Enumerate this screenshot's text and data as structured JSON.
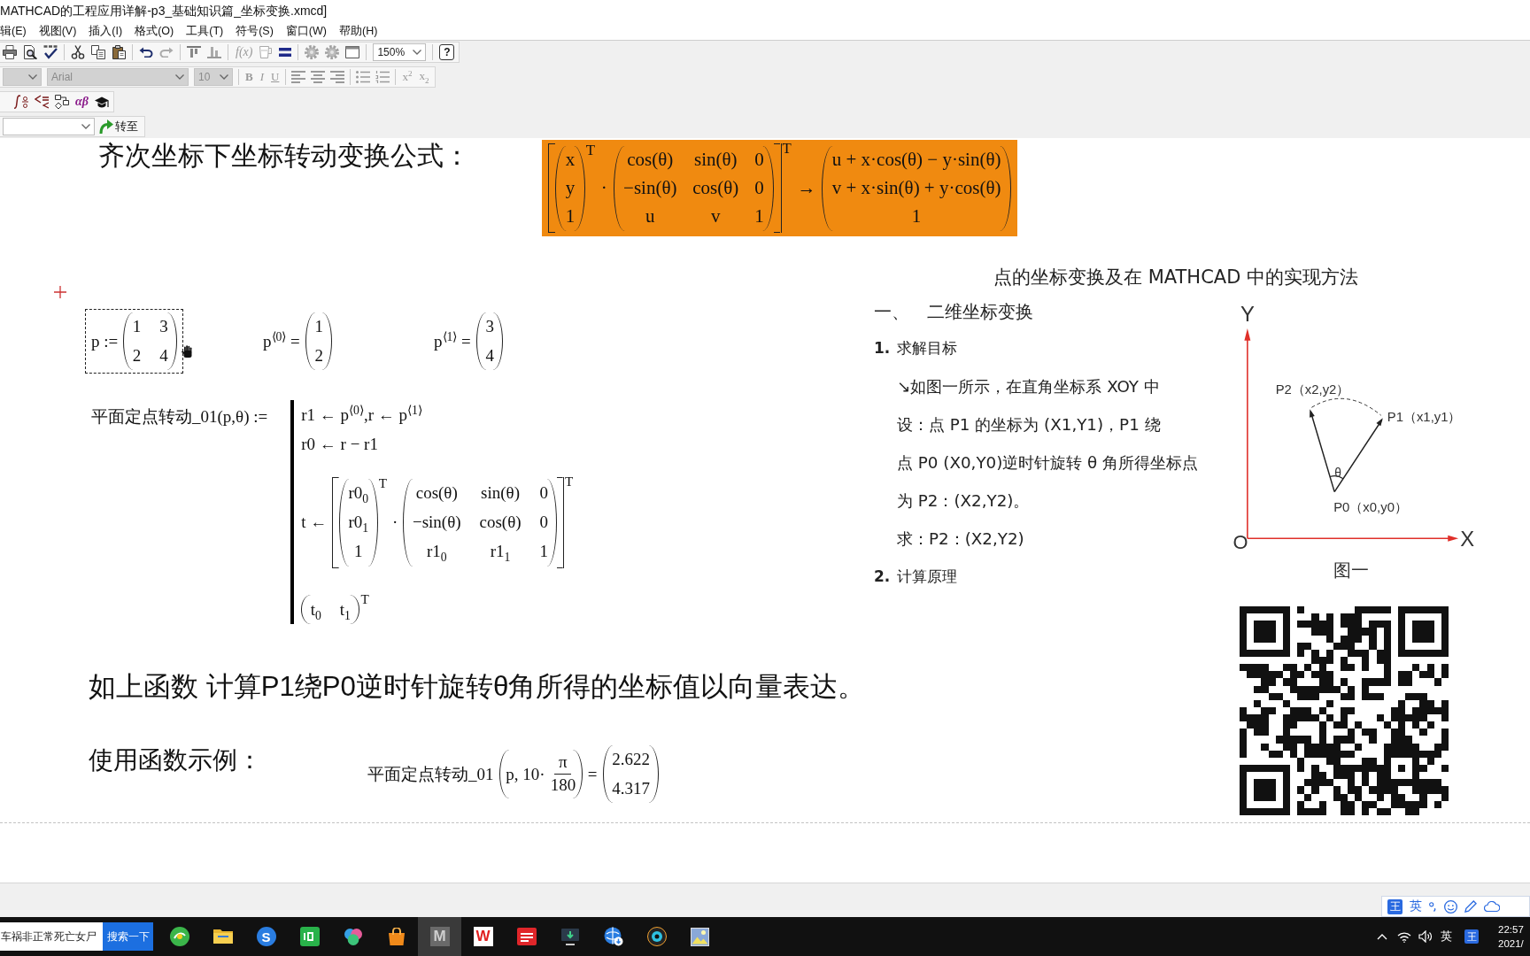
{
  "window": {
    "title": "MATHCAD的工程应用详解-p3_基础知识篇_坐标变换.xmcd]"
  },
  "menu": [
    "辑(E)",
    "视图(V)",
    "插入(I)",
    "格式(O)",
    "工具(T)",
    "符号(S)",
    "窗口(W)",
    "帮助(H)"
  ],
  "standard_toolbar": {
    "function": {
      "label": "f(x)",
      "disabled": true
    },
    "zoom": "150%",
    "help": "?"
  },
  "formatting_toolbar": {
    "disabled": true,
    "font": "Arial",
    "size": "10",
    "styles": [
      "B",
      "I",
      "U"
    ],
    "scripts": [
      "x$^{2}$",
      "x$_{2}$"
    ]
  },
  "math_toolbar": {
    "greek": "αβ"
  },
  "resource_toolbar": {
    "goto": "转至"
  },
  "worksheet": {
    "regions": [
      {
        "kind": "text",
        "selected": false,
        "text": "齐次坐标下坐标转动变换公式："
      },
      {
        "kind": "math",
        "selected": false,
        "highlighted": true,
        "expr": [
          {
            "kind": "square_group",
            "sup": "T",
            "items": [
              {
                "kind": "matrix",
                "sup": "T",
                "rows": [
                  [
                    "x"
                  ],
                  [
                    "y"
                  ],
                  [
                    "1"
                  ]
                ]
              },
              {
                "kind": "text",
                "text": "·"
              },
              {
                "kind": "matrix",
                "rows": [
                  [
                    "cos(θ)",
                    "sin(θ)",
                    "0"
                  ],
                  [
                    "−sin(θ)",
                    "cos(θ)",
                    "0"
                  ],
                  [
                    "u",
                    "v",
                    "1"
                  ]
                ]
              }
            ]
          },
          {
            "kind": "text",
            "text": "→"
          },
          {
            "kind": "matrix",
            "rows": [
              [
                "u + x·cos(θ) − y·sin(θ)"
              ],
              [
                "v + x·sin(θ) + y·cos(θ)"
              ],
              [
                "1"
              ]
            ]
          }
        ]
      },
      {
        "kind": "math",
        "selected": true,
        "highlighted": false,
        "expr": [
          {
            "kind": "text",
            "text": "p :="
          },
          {
            "kind": "matrix",
            "rows": [
              [
                "1",
                "3"
              ],
              [
                "2",
                "4"
              ]
            ]
          }
        ]
      },
      {
        "kind": "math",
        "selected": false,
        "highlighted": false,
        "expr": [
          {
            "kind": "text",
            "text": "p$^{⟨0⟩}$ ="
          },
          {
            "kind": "matrix",
            "rows": [
              [
                "1"
              ],
              [
                "2"
              ]
            ]
          }
        ]
      },
      {
        "kind": "math",
        "selected": false,
        "highlighted": false,
        "expr": [
          {
            "kind": "text",
            "text": "p$^{⟨1⟩}$ ="
          },
          {
            "kind": "matrix",
            "rows": [
              [
                "3"
              ],
              [
                "4"
              ]
            ]
          }
        ]
      },
      {
        "kind": "math",
        "selected": false,
        "highlighted": false,
        "expr": [
          {
            "kind": "text",
            "text": "平面定点转动_01(p,θ) :="
          },
          {
            "kind": "program",
            "lines": [
              [
                {
                  "kind": "text",
                  "text": "r1 ← p$^{⟨0⟩}$,r ← p$^{⟨1⟩}$"
                }
              ],
              [
                {
                  "kind": "text",
                  "text": "r0 ← r − r1"
                }
              ],
              [
                {
                  "kind": "text",
                  "text": "t ←"
                },
                {
                  "kind": "square_group",
                  "sup": "T",
                  "items": [
                    {
                      "kind": "matrix",
                      "sup": "T",
                      "rows": [
                        [
                          "r0$_{0}$"
                        ],
                        [
                          "r0$_{1}$"
                        ],
                        [
                          "1"
                        ]
                      ]
                    },
                    {
                      "kind": "text",
                      "text": "·"
                    },
                    {
                      "kind": "matrix",
                      "rows": [
                        [
                          "cos(θ)",
                          "sin(θ)",
                          "0"
                        ],
                        [
                          "−sin(θ)",
                          "cos(θ)",
                          "0"
                        ],
                        [
                          "r1$_{0}$",
                          "r1$_{1}$",
                          "1"
                        ]
                      ]
                    }
                  ]
                }
              ],
              [
                {
                  "kind": "matrix",
                  "sup": "T",
                  "rows": [
                    [
                      "t$_{0}$",
                      "t$_{1}$"
                    ]
                  ]
                }
              ]
            ]
          }
        ]
      },
      {
        "kind": "text",
        "selected": false,
        "text": "如上函数 计算P1绕P0逆时针旋转θ角所得的坐标值以向量表达。"
      },
      {
        "kind": "text",
        "selected": false,
        "text": "使用函数示例："
      },
      {
        "kind": "math",
        "selected": false,
        "highlighted": false,
        "expr": [
          {
            "kind": "text",
            "text": "平面定点转动_01"
          },
          {
            "kind": "paren_group",
            "items": [
              {
                "kind": "text",
                "text": "p, 10·"
              },
              {
                "kind": "frac",
                "num": "π",
                "den": "180"
              }
            ]
          },
          {
            "kind": "text",
            "text": "="
          },
          {
            "kind": "matrix",
            "rows": [
              [
                "2.622"
              ],
              [
                "4.317"
              ]
            ]
          }
        ]
      },
      {
        "kind": "document",
        "selected": false,
        "title": "点的坐标变换及在 MATHCAD 中的实现方法",
        "chapter": {
          "number": "一、",
          "title": "二维坐标变换"
        },
        "sections": [
          {
            "number": "1.",
            "title": "求解目标",
            "lines": [
              "↘如图一所示，在直角坐标系 XOY 中",
              "设：点 P1 的坐标为 (X1,Y1)，P1 绕",
              "点 P0 (X0,Y0)逆时针旋转 θ 角所得坐标点",
              "为 P2：(X2,Y2)。"
            ],
            "question": "求：P2：(X2,Y2)"
          },
          {
            "number": "2.",
            "title": "计算原理"
          }
        ],
        "figure": {
          "y_axis": "Y",
          "x_axis": "X",
          "origin": "O",
          "points": [
            "P2（x2,y2）",
            "P1（x1,y1）",
            "P0（x0,y0）"
          ],
          "angle": "θ",
          "caption": "图一"
        }
      },
      {
        "kind": "qr",
        "selected": false
      }
    ]
  },
  "ime_bar": {
    "logo": "王",
    "mode": "英"
  },
  "taskbar": {
    "search": {
      "value": "车祸非正常死亡女尸",
      "button": "搜索一下"
    },
    "apps": [
      {
        "active": false
      },
      {
        "active": false
      },
      {
        "active": false,
        "label": "S"
      },
      {
        "active": false
      },
      {
        "active": false
      },
      {
        "active": false
      },
      {
        "active": true,
        "label": "M"
      },
      {
        "active": false,
        "label": "W"
      },
      {
        "active": false
      },
      {
        "active": false
      },
      {
        "active": false
      },
      {
        "active": false
      },
      {
        "active": false
      }
    ],
    "tray": {
      "input_mode": "英",
      "ime": "王",
      "time": "22:57",
      "date": "2021/"
    }
  }
}
